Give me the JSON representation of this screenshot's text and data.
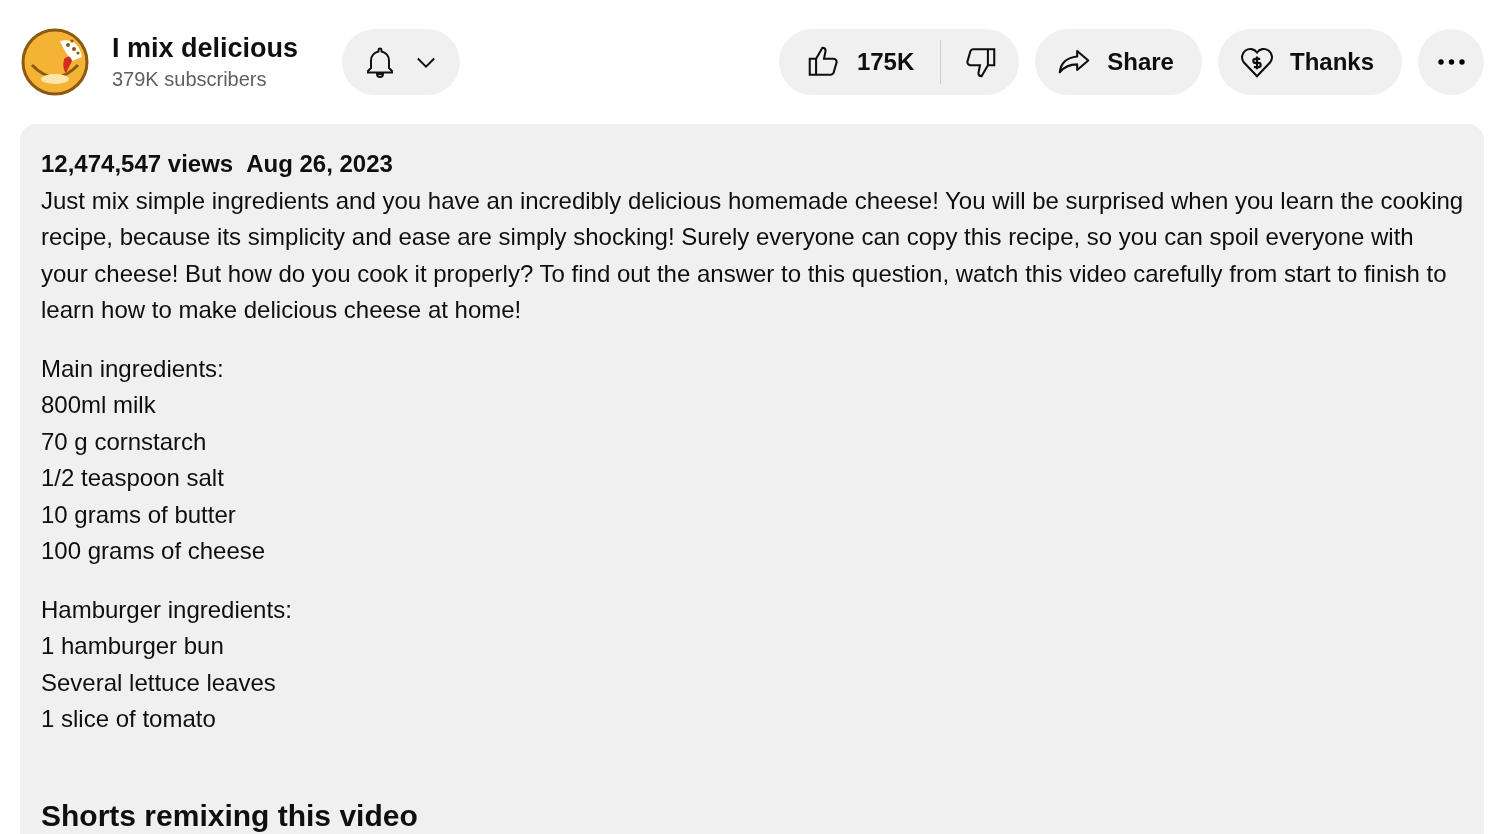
{
  "channel": {
    "name": "I mix delicious",
    "subscribers": "379K subscribers"
  },
  "actions": {
    "likes": "175K",
    "share": "Share",
    "thanks": "Thanks"
  },
  "description": {
    "views": "12,474,547 views",
    "date": "Aug 26, 2023",
    "text": "Just mix simple ingredients and you have an incredibly delicious homemade cheese! You will be surprised when you learn the cooking recipe, because its simplicity and ease are simply shocking! Surely everyone can copy this recipe, so you can spoil everyone with your cheese! But how do you cook it properly? To find out the answer to this question, watch this video carefully from start to finish to learn how to make delicious cheese at home!",
    "sections": [
      {
        "heading": "Main ingredients:",
        "items": [
          "800ml milk",
          "70 g cornstarch",
          "1/2 teaspoon salt",
          "10 grams of butter",
          "100 grams of cheese"
        ]
      },
      {
        "heading": "Hamburger ingredients:",
        "items": [
          "1 hamburger bun",
          "Several lettuce leaves",
          "1 slice of tomato"
        ]
      }
    ],
    "shorts_heading": "Shorts remixing this video"
  }
}
